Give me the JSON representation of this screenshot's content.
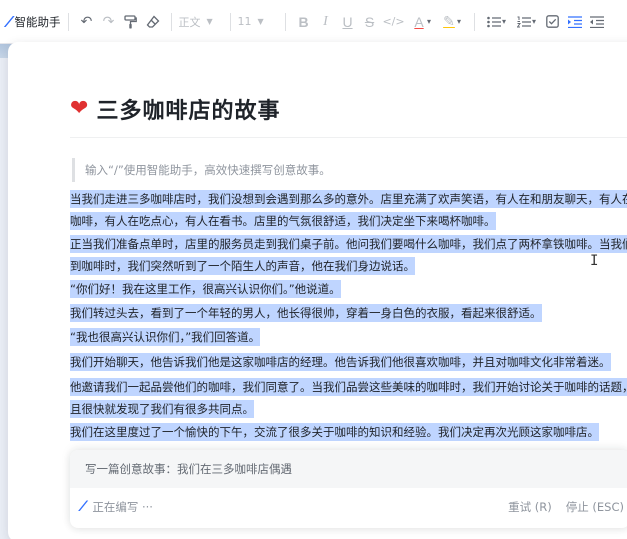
{
  "toolbar": {
    "ai_label": "智能助手",
    "style_value": "正文",
    "size_value": "11",
    "icons": [
      "undo-icon",
      "redo-icon",
      "format-painter-icon",
      "eraser-icon",
      "bold-icon",
      "italic-icon",
      "underline-icon",
      "strikethrough-icon",
      "code-icon",
      "font-color-icon",
      "highlight-icon",
      "bullet-list-icon",
      "ordered-list-icon",
      "checkbox-icon",
      "indent-icon",
      "outdent-icon"
    ],
    "undo": "↶",
    "redo": "↷",
    "bold": "B",
    "italic": "I",
    "underline": "U",
    "strike": "S",
    "code": "</>",
    "font_color": "A",
    "highlight": "✎"
  },
  "doc": {
    "title_emoji": "❤️",
    "title": "三多咖啡店的故事",
    "hint": "输入“/”使用智能助手，高效快速撰写创意故事。",
    "paragraphs": [
      [
        "当我们走进三多咖啡店时，我们没想到会遇到那么多的意外。店里充满了欢声笑语，有人在和朋友聊天，有人在喝",
        "咖啡，有人在吃点心，有人在看书。店里的气氛很舒适，我们决定坐下来喝杯咖啡。"
      ],
      [
        "正当我们准备点单时，店里的服务员走到我们桌子前。他问我们要喝什么咖啡，我们点了两杯拿铁咖啡。当我们拿",
        "到咖啡时，我们突然听到了一个陌生人的声音，他在我们身边说话。"
      ],
      [
        "“你们好！我在这里工作，很高兴认识你们。”他说道。"
      ],
      [
        "我们转过头去，看到了一个年轻的男人，他长得很帅，穿着一身白色的衣服，看起来很舒适。"
      ],
      [
        "“我也很高兴认识你们，”我们回答道。"
      ],
      [
        "我们开始聊天，他告诉我们他是这家咖啡店的经理。他告诉我们他很喜欢咖啡，并且对咖啡文化非常着迷。"
      ],
      [
        "他邀请我们一起品尝他们的咖啡，我们同意了。当我们品尝这些美味的咖啡时，我们开始讨论关于咖啡的话题，并",
        "且很快就发现了我们有很多共同点。"
      ],
      [
        "我们在这里度过了一个愉快的下午，交流了很多关于咖啡的知识和经验。我们决定再次光顾这家咖啡店。"
      ]
    ]
  },
  "ai_panel": {
    "prompt": "写一篇创意故事：我们在三多咖啡店偶遇",
    "status": "正在编写 ···",
    "retry": "重试 (R)",
    "stop": "停止 (ESC)"
  },
  "colors": {
    "accent": "#3370ff",
    "selection": "#bfd5ff",
    "text": "#1f2329",
    "muted": "#8f959e"
  }
}
